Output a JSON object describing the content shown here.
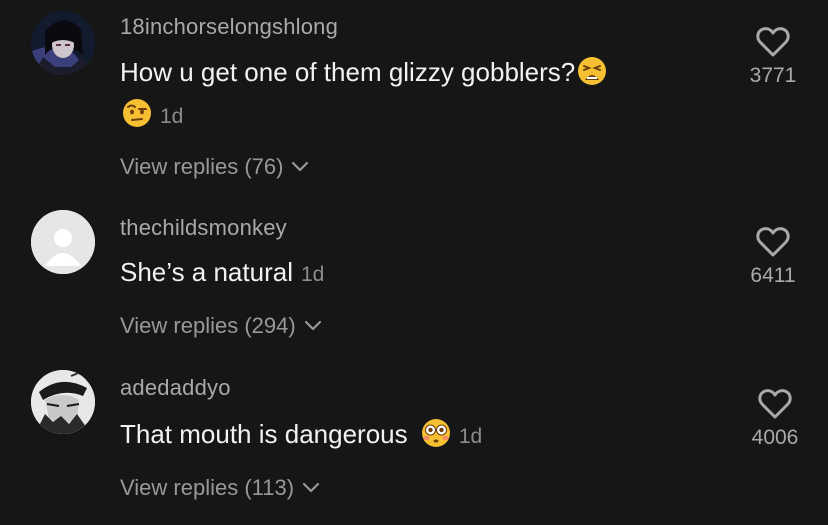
{
  "comments": [
    {
      "username": "18inchorselongshlong",
      "text_line1": "How u get one of them glizzy gobblers?",
      "emoji1": "tired-face-emoji",
      "emoji2": "raised-eyebrow-emoji",
      "time": "1d",
      "view_replies": "View replies (76)",
      "likes": "3771",
      "avatar": "anime-character-avatar"
    },
    {
      "username": "thechildsmonkey",
      "text": "She’s a natural",
      "time": "1d",
      "view_replies": "View replies (294)",
      "likes": "6411",
      "avatar": "default-user-avatar"
    },
    {
      "username": "adedaddyo",
      "text": "That mouth is dangerous",
      "emoji": "flushed-face-emoji",
      "time": "1d",
      "view_replies": "View replies (113)",
      "likes": "4006",
      "avatar": "manga-character-avatar"
    }
  ],
  "colors": {
    "background": "#161616",
    "username": "#a9a9aa",
    "text": "#f2f2f2",
    "secondary": "#8c8c8d"
  }
}
